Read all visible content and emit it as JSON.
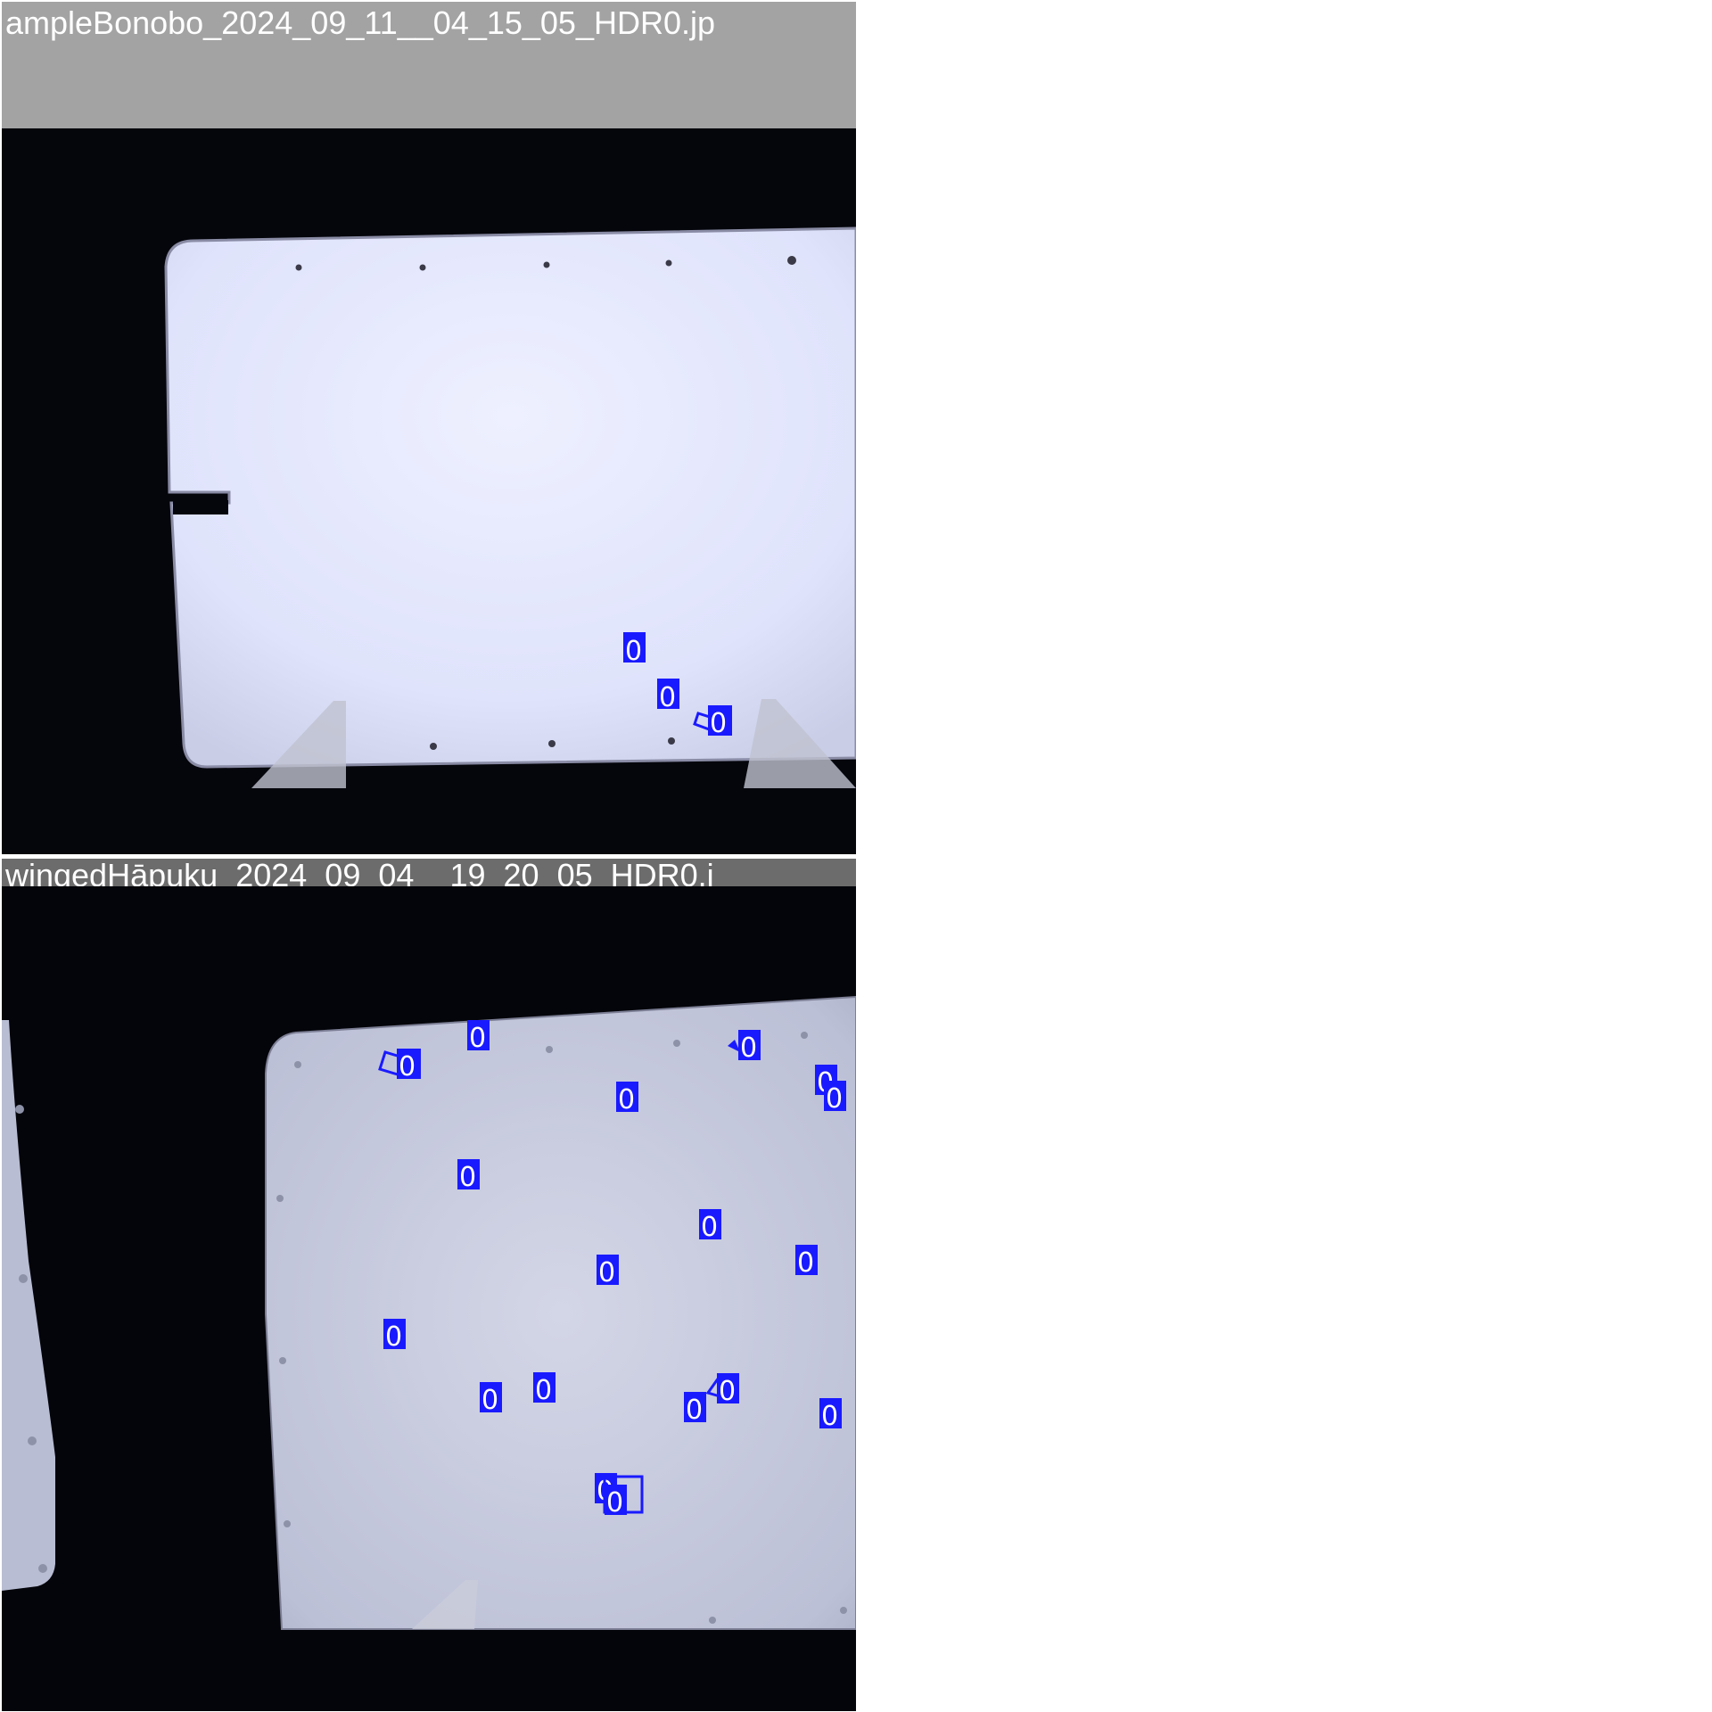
{
  "panels": [
    {
      "title": "ampleBonobo_2024_09_11__04_15_05_HDR0.jp",
      "detections": [
        {
          "label": "0"
        },
        {
          "label": "0"
        },
        {
          "label": "0"
        }
      ]
    },
    {
      "title": "wingedHāpuku_2024_09_04__19_20_05_HDR0.j",
      "detections": [
        {
          "label": "0"
        },
        {
          "label": "0"
        },
        {
          "label": "0"
        },
        {
          "label": "0"
        },
        {
          "label": "0"
        },
        {
          "label": "0"
        },
        {
          "label": "0"
        },
        {
          "label": "0"
        },
        {
          "label": "0"
        },
        {
          "label": "0"
        },
        {
          "label": "0"
        },
        {
          "label": "0"
        },
        {
          "label": "0"
        },
        {
          "label": "0"
        },
        {
          "label": "0"
        },
        {
          "label": "0"
        },
        {
          "label": "0"
        },
        {
          "label": "0"
        },
        {
          "label": "0"
        }
      ]
    }
  ],
  "colors": {
    "detection_box": "#1a1aff",
    "background": "#000000",
    "panel_1_title_bar": "#a3a3a3",
    "panel_2_title_bar": "#6c6c6c",
    "plate": "#e2e6fb"
  }
}
